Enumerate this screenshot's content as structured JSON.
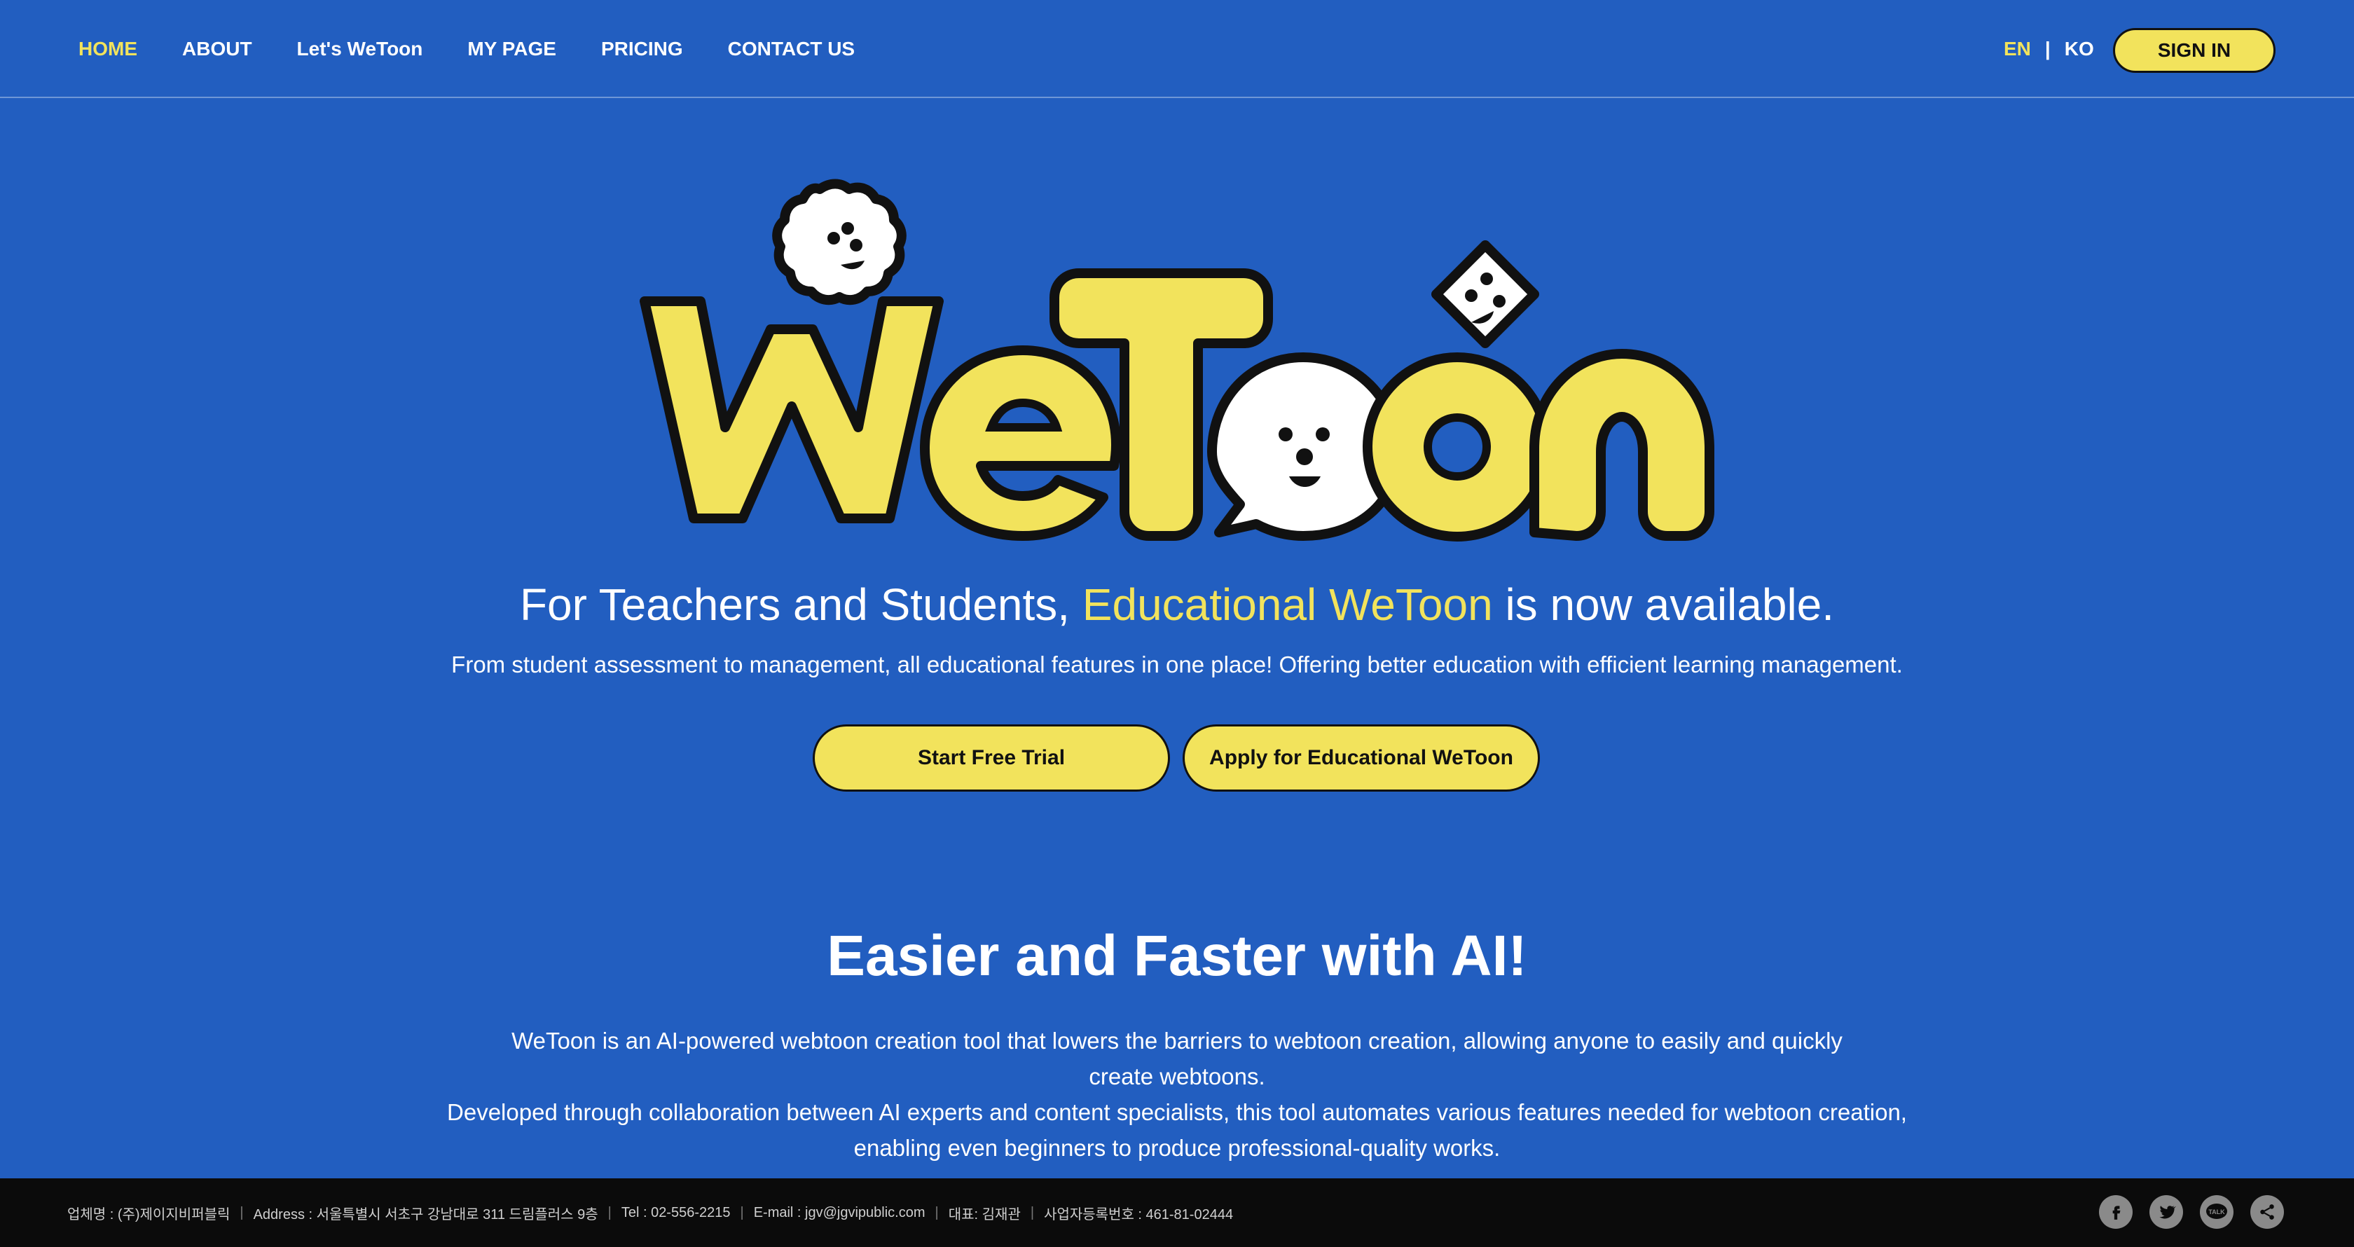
{
  "nav": {
    "items": [
      {
        "label": "HOME",
        "active": true
      },
      {
        "label": "ABOUT",
        "active": false
      },
      {
        "label": "Let's WeToon",
        "active": false
      },
      {
        "label": "MY PAGE",
        "active": false
      },
      {
        "label": "PRICING",
        "active": false
      },
      {
        "label": "CONTACT US",
        "active": false
      }
    ],
    "lang_en": "EN",
    "lang_sep": "|",
    "lang_ko": "KO",
    "signin": "SIGN IN"
  },
  "hero": {
    "logo_text": "WeToon",
    "headline_pre": "For Teachers and Students, ",
    "headline_highlight": "Educational WeToon",
    "headline_post": " is now available.",
    "subline": "From student assessment to management, all educational features in one place! Offering better education with efficient learning management.",
    "btn_trial": "Start Free Trial",
    "btn_apply": "Apply for Educational WeToon"
  },
  "section": {
    "title": "Easier and Faster with AI!",
    "line1": "WeToon is an AI-powered webtoon creation tool that lowers the barriers to webtoon creation, allowing anyone to easily and quickly",
    "line2": "create webtoons.",
    "line3": "Developed through collaboration between AI experts and content specialists, this tool automates various features needed for webtoon creation,",
    "line4": "enabling even beginners to produce professional-quality works."
  },
  "footer": {
    "company": "업체명 : (주)제이지비퍼블릭",
    "address": "Address : 서울특별시 서초구 강남대로 311 드림플러스 9층",
    "tel": "Tel : 02-556-2215",
    "email": "E-mail : jgv@jgvipublic.com",
    "ceo": "대표: 김재관",
    "bizno": "사업자등록번호 : 461-81-02444",
    "social": [
      "facebook-icon",
      "twitter-icon",
      "kakaotalk-icon",
      "share-icon"
    ],
    "kakao_label": "TALK"
  },
  "colors": {
    "background": "#225EC0",
    "accent": "#F2E35C",
    "footer": "#0B0B0B"
  }
}
